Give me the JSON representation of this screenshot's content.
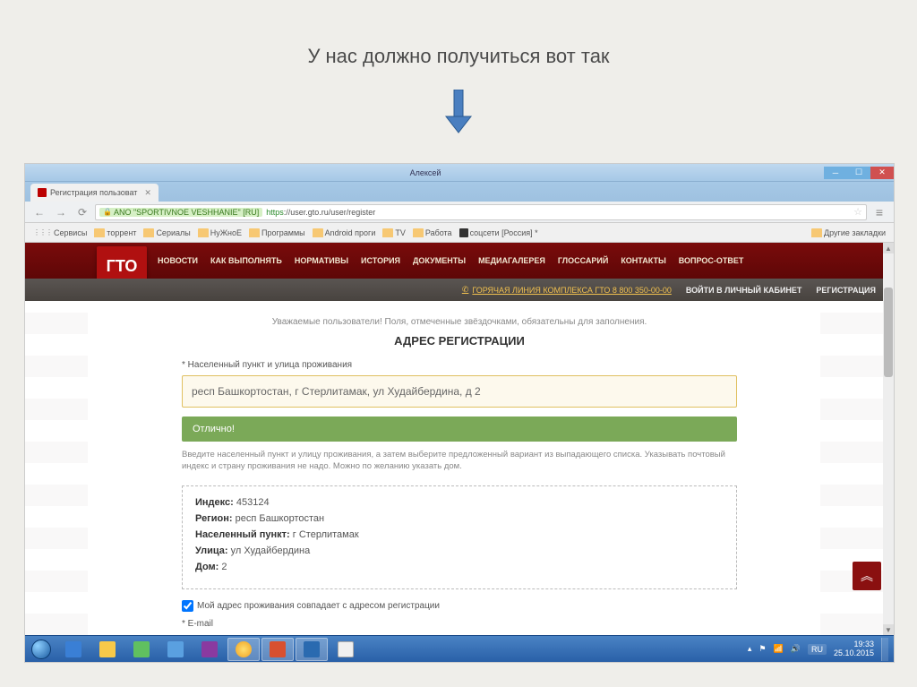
{
  "caption": "У нас должно получиться вот так",
  "browser": {
    "window_user": "Алексей",
    "tab_title": "Регистрация пользоват",
    "ssl_name": "ANO \"SPORTIVNOE VESHHANIE\" [RU]",
    "url_proto": "https",
    "url_rest": "://user.gto.ru/user/register",
    "bookmarks": {
      "apps": "Сервисы",
      "items": [
        "торрент",
        "Сериалы",
        "НуЖноЕ",
        "Программы",
        "Android проги",
        "TV",
        "Работа",
        "соцсети [Россия] *"
      ],
      "other": "Другие закладки"
    }
  },
  "site": {
    "logo": "ГТО",
    "nav": [
      "НОВОСТИ",
      "КАК ВЫПОЛНЯТЬ",
      "НОРМАТИВЫ",
      "ИСТОРИЯ",
      "ДОКУМЕНТЫ",
      "МЕДИАГАЛЕРЕЯ",
      "ГЛОССАРИЙ",
      "КОНТАКТЫ",
      "ВОПРОС-ОТВЕТ"
    ],
    "hotline": "ГОРЯЧАЯ ЛИНИЯ КОМПЛЕКСА ГТО 8 800 350-00-00",
    "login": "ВОЙТИ В ЛИЧНЫЙ КАБИНЕТ",
    "register": "РЕГИСТРАЦИЯ"
  },
  "form": {
    "notice": "Уважаемые пользователи! Поля, отмеченные звёздочками, обязательны для заполнения.",
    "section": "АДРЕС РЕГИСТРАЦИИ",
    "field_label": "* Населенный пункт и улица проживания",
    "field_value": "респ Башкортостан, г Стерлитамак, ул Худайбердина, д 2",
    "success": "Отлично!",
    "hint": "Введите населенный пункт и улицу проживания, а затем выберите предложенный вариант из выпадающего списка. Указывать почтовый индекс и страну проживания не надо. Можно по желанию указать дом.",
    "details": {
      "index_label": "Индекс:",
      "index_val": "453124",
      "region_label": "Регион:",
      "region_val": "респ Башкортостан",
      "city_label": "Населенный пункт:",
      "city_val": "г Стерлитамак",
      "street_label": "Улица:",
      "street_val": "ул Худайбердина",
      "house_label": "Дом:",
      "house_val": "2"
    },
    "same_addr": "Мой адрес проживания совпадает с адресом регистрации",
    "email_label": "* E-mail"
  },
  "taskbar": {
    "lang": "RU",
    "time": "19:33",
    "date": "25.10.2015"
  }
}
